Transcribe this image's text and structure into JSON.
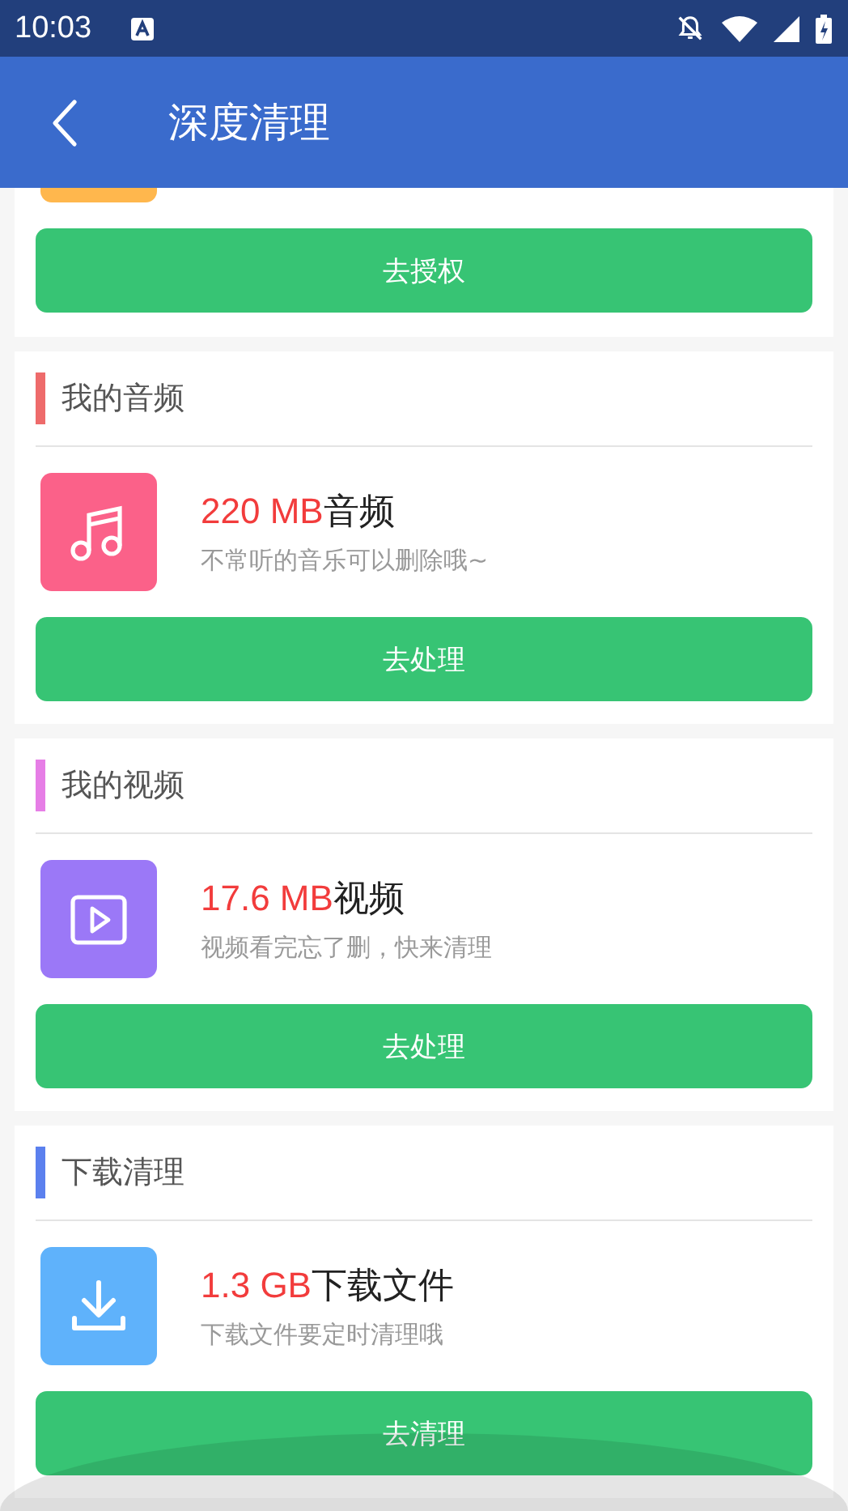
{
  "status_bar": {
    "time": "10:03"
  },
  "app_bar": {
    "title": "深度清理"
  },
  "partial_card": {
    "icon": {
      "color": "#ffb74d"
    },
    "button": "去授权"
  },
  "cards": [
    {
      "title": "我的音频",
      "accent": {
        "color": "#ee6b6b"
      },
      "kind": "music",
      "tile": {
        "color": "#fb6189"
      },
      "amount": "220 MB",
      "label": "音频",
      "description": "不常听的音乐可以删除哦~",
      "button": "去处理"
    },
    {
      "title": "我的视频",
      "accent": {
        "color": "#e67ee6"
      },
      "kind": "video",
      "tile": {
        "color": "#9b78f7"
      },
      "amount": "17.6 MB",
      "label": "视频",
      "description": "视频看完忘了删，快来清理",
      "button": "去处理"
    },
    {
      "title": "下载清理",
      "accent": {
        "color": "#5b80ee"
      },
      "kind": "download",
      "tile": {
        "color": "#5fb2fb"
      },
      "amount": "1.3 GB",
      "label": "下载文件",
      "description": "下载文件要定时清理哦",
      "button": "去清理"
    }
  ]
}
